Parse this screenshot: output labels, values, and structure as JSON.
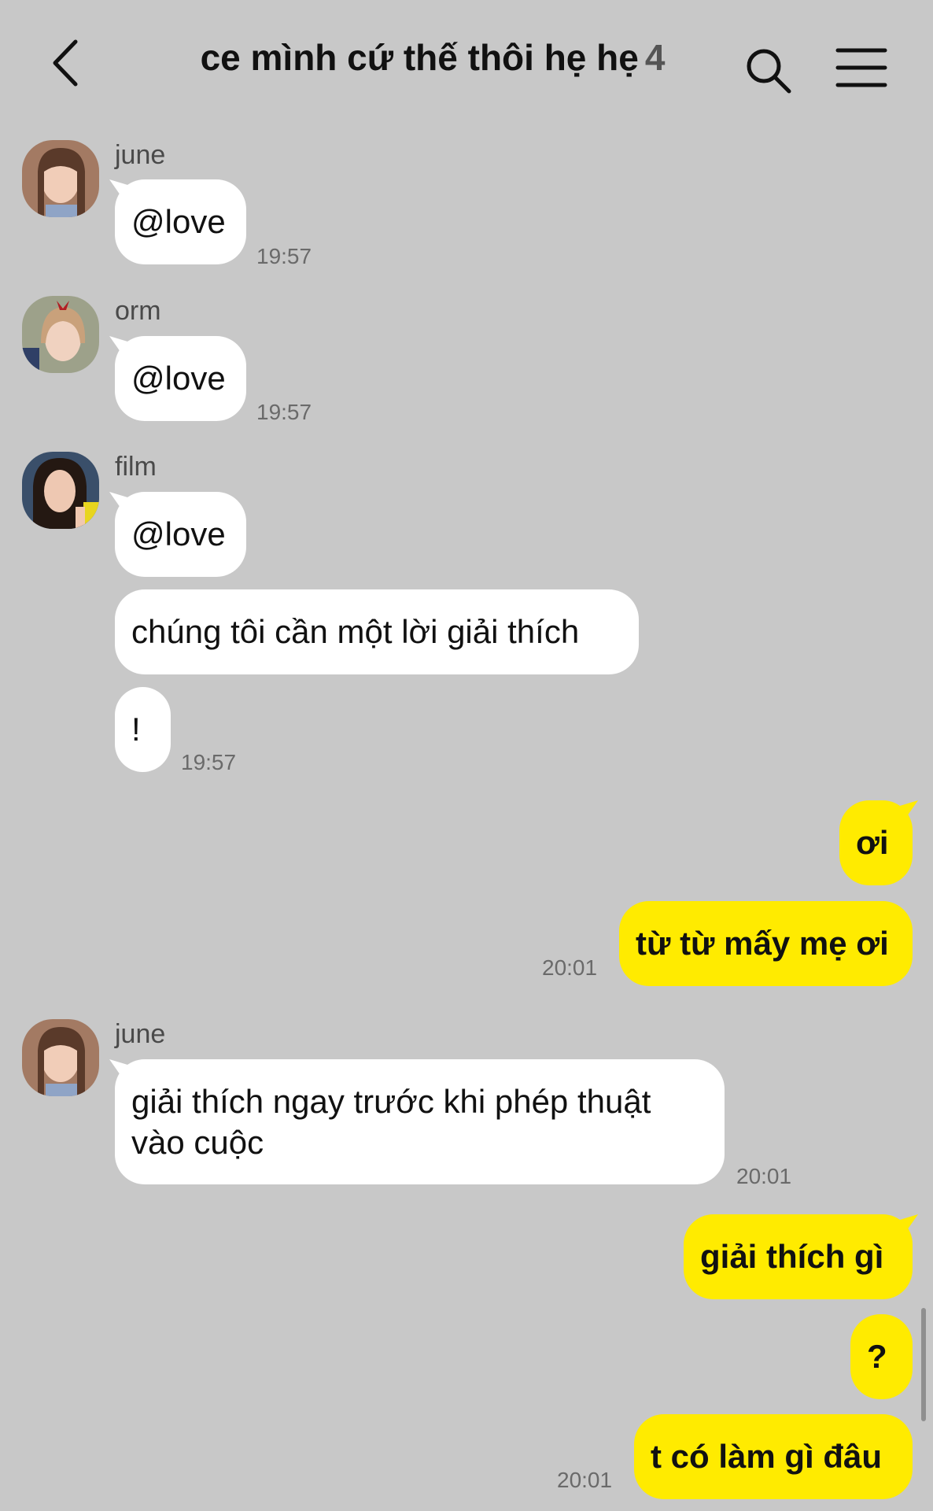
{
  "header": {
    "title": "ce mình cứ thế thôi hẹ hẹ",
    "member_count": "4",
    "back_icon": "chevron-left-icon",
    "search_icon": "search-icon",
    "menu_icon": "menu-icon"
  },
  "messages": [
    {
      "sender": "june",
      "text": "@love",
      "time": "19:57"
    },
    {
      "sender": "orm",
      "text": "@love",
      "time": "19:57"
    },
    {
      "sender": "film",
      "texts": [
        "@love",
        "chúng tôi cần một lời giải thích",
        "!"
      ],
      "time": "19:57"
    },
    {
      "sender": "me",
      "texts": [
        "ơi",
        "từ từ mấy mẹ ơi"
      ],
      "time": "20:01"
    },
    {
      "sender": "june",
      "text": "giải thích ngay trước khi phép thuật vào cuộc",
      "time": "20:01"
    },
    {
      "sender": "me",
      "texts": [
        "giải thích gì",
        "?",
        "t có làm gì đâu"
      ],
      "time": "20:01"
    }
  ],
  "colors": {
    "background": "#c8c8c8",
    "incoming_bubble": "#ffffff",
    "outgoing_bubble": "#ffeb00"
  }
}
